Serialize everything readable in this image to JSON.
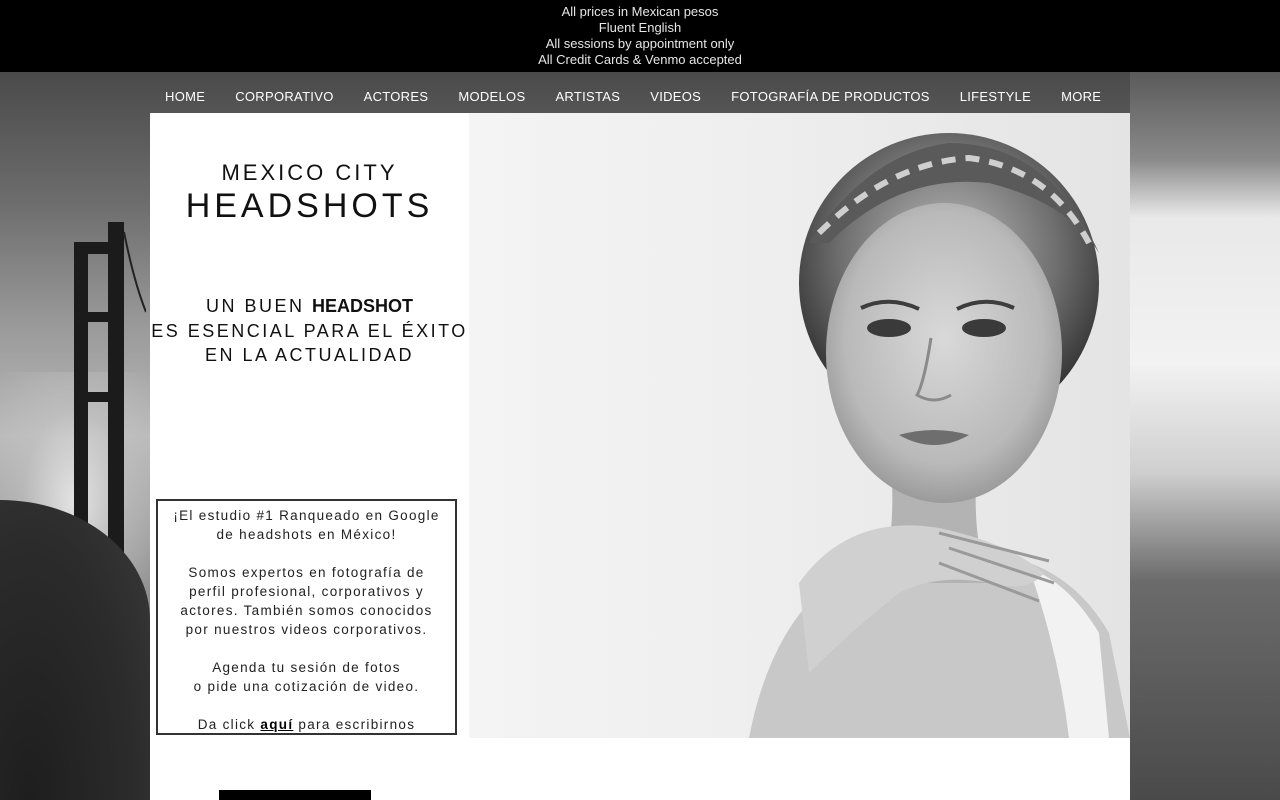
{
  "topbar": {
    "lines": [
      "All prices in Mexican pesos",
      "Fluent English",
      "All sessions by appointment only",
      "All Credit Cards & Venmo accepted"
    ]
  },
  "nav": {
    "items": [
      "HOME",
      "CORPORATIVO",
      "ACTORES",
      "MODELOS",
      "ARTISTAS",
      "VIDEOS",
      "FOTOGRAFÍA DE PRODUCTOS",
      "LIFESTYLE",
      "MORE"
    ]
  },
  "hero": {
    "title_line1": "MEXICO CITY",
    "title_line2": "HEADSHOTS",
    "tagline_prefix": "UN BUEN ",
    "tagline_bold": "HEADSHOT",
    "tagline_line2": "ES ESENCIAL PARA EL ÉXITO",
    "tagline_line3": "EN LA ACTUALIDAD"
  },
  "info_box": {
    "p1_line1": "¡El estudio #1 Ranqueado en Google",
    "p1_line2": "de headshots en México!",
    "p2_line1": "Somos expertos en fotografía de",
    "p2_line2": "perfil profesional, corporativos y",
    "p2_line3": "actores. También somos conocidos",
    "p2_line4": "por nuestros videos corporativos.",
    "p3_line1": "Agenda tu sesión de fotos",
    "p3_line2": "o pide una cotización de video.",
    "p4_prefix": "Da click ",
    "p4_link": "aquí",
    "p4_suffix": " para escribirnos"
  },
  "colors": {
    "topbar_bg": "#000000",
    "card_bg": "#ffffff",
    "accent": "#000000"
  },
  "icons": {
    "hero_photo": "portrait-photo",
    "background": "golden-gate-bridge-fog"
  }
}
